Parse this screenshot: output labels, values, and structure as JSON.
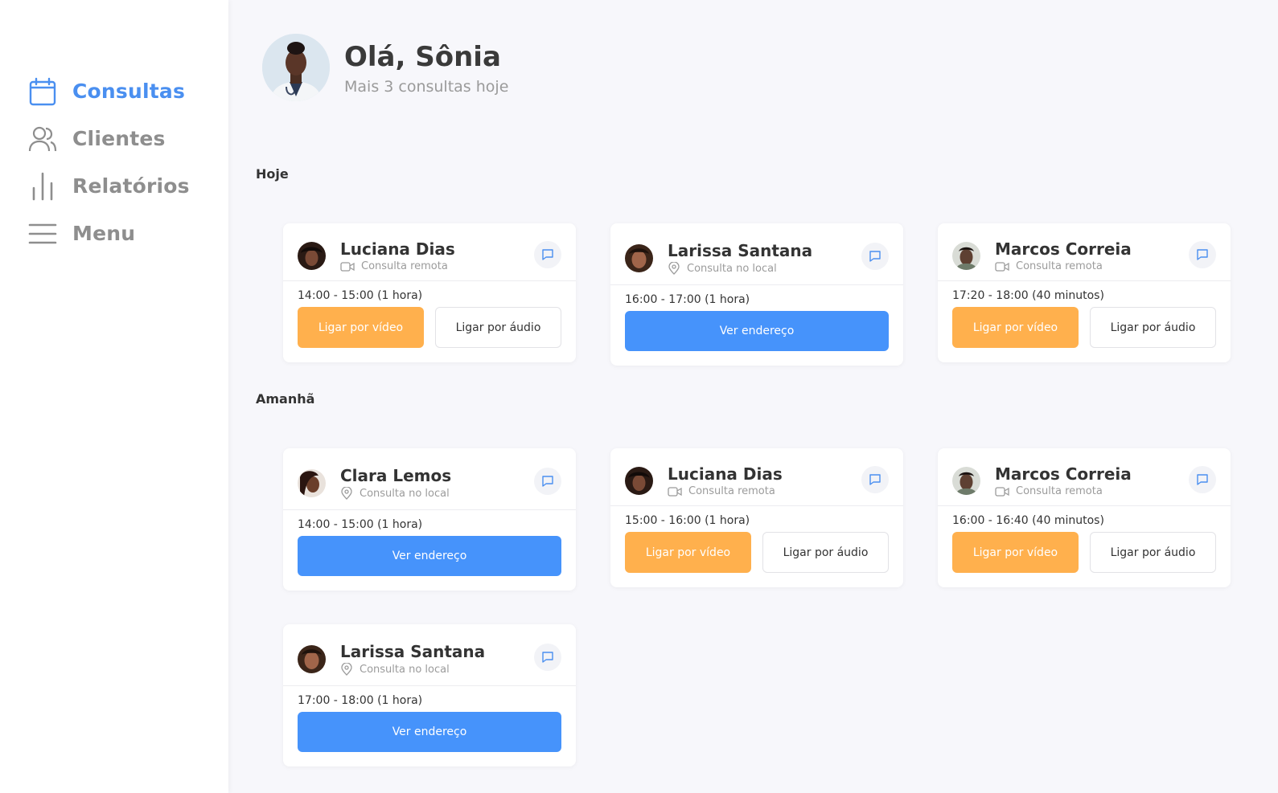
{
  "sidebar": {
    "items": [
      {
        "label": "Consultas",
        "icon": "calendar-icon",
        "active": true
      },
      {
        "label": "Clientes",
        "icon": "users-icon",
        "active": false
      },
      {
        "label": "Relatórios",
        "icon": "bar-chart-icon",
        "active": false
      },
      {
        "label": "Menu",
        "icon": "hamburger-icon",
        "active": false
      }
    ]
  },
  "header": {
    "greeting": "Olá, Sônia",
    "subtitle": "Mais 3 consultas hoje"
  },
  "sections": [
    {
      "title": "Hoje",
      "cards": [
        {
          "name": "Luciana Dias",
          "kind": "Consulta remota",
          "kind_icon": "video-icon",
          "time": "14:00 - 15:00 (1 hora)",
          "actions": [
            "Ligar por vídeo",
            "Ligar por áudio"
          ]
        },
        {
          "name": "Larissa Santana",
          "kind": "Consulta no local",
          "kind_icon": "location-pin-icon",
          "time": "16:00 - 17:00 (1 hora)",
          "actions": [
            "Ver endereço"
          ]
        },
        {
          "name": "Marcos Correia",
          "kind": "Consulta remota",
          "kind_icon": "video-icon",
          "time": "17:20 - 18:00 (40 minutos)",
          "actions": [
            "Ligar por vídeo",
            "Ligar por áudio"
          ]
        }
      ]
    },
    {
      "title": "Amanhã",
      "cards": [
        {
          "name": "Clara Lemos",
          "kind": "Consulta no local",
          "kind_icon": "location-pin-icon",
          "time": "14:00 - 15:00 (1 hora)",
          "actions": [
            "Ver endereço"
          ]
        },
        {
          "name": "Luciana Dias",
          "kind": "Consulta remota",
          "kind_icon": "video-icon",
          "time": "15:00 - 16:00 (1 hora)",
          "actions": [
            "Ligar por vídeo",
            "Ligar por áudio"
          ]
        },
        {
          "name": "Marcos Correia",
          "kind": "Consulta remota",
          "kind_icon": "video-icon",
          "time": "16:00 - 16:40 (40 minutos)",
          "actions": [
            "Ligar por vídeo",
            "Ligar por áudio"
          ]
        },
        {
          "name": "Larissa Santana",
          "kind": "Consulta no local",
          "kind_icon": "location-pin-icon",
          "time": "17:00 - 18:00 (1 hora)",
          "actions": [
            "Ver endereço"
          ]
        }
      ]
    }
  ],
  "colors": {
    "accent": "#4a8ff0",
    "video_button": "#ffb04d",
    "address_button": "#4693fb",
    "inactive_nav": "#8e8e8e",
    "background": "#f7f7fb"
  }
}
